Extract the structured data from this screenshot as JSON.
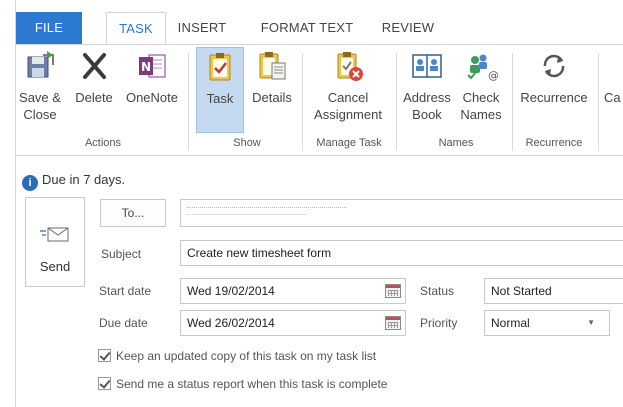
{
  "tabs": [
    {
      "label": "FILE"
    },
    {
      "label": "TASK"
    },
    {
      "label": "INSERT"
    },
    {
      "label": "FORMAT TEXT"
    },
    {
      "label": "REVIEW"
    }
  ],
  "ribbon": {
    "buttons": {
      "save_close": {
        "line1": "Save &",
        "line2": "Close",
        "icon": "save-close-icon"
      },
      "delete": {
        "line1": "Delete",
        "icon": "delete-x-icon"
      },
      "onenote": {
        "line1": "OneNote",
        "icon": "onenote-icon"
      },
      "task": {
        "line1": "Task",
        "icon": "task-clipboard-icon"
      },
      "details": {
        "line1": "Details",
        "icon": "details-clipboard-icon"
      },
      "cancel_assignment": {
        "line1": "Cancel",
        "line2": "Assignment",
        "icon": "cancel-assignment-icon"
      },
      "address_book": {
        "line1": "Address",
        "line2": "Book",
        "icon": "address-book-icon"
      },
      "check_names": {
        "line1": "Check",
        "line2": "Names",
        "icon": "check-names-icon"
      },
      "recurrence": {
        "line1": "Recurrence",
        "icon": "recurrence-icon"
      },
      "categorize": {
        "line1": "Ca"
      }
    },
    "groups": {
      "actions": "Actions",
      "show": "Show",
      "manage_task": "Manage Task",
      "names": "Names",
      "recurrence": "Recurrence"
    }
  },
  "info_bar": {
    "text": "Due in 7 days."
  },
  "send": {
    "label": "Send"
  },
  "form": {
    "to_button": "To...",
    "to_value": "",
    "subject_label": "Subject",
    "subject_value": "Create new timesheet form",
    "start_label": "Start date",
    "start_value": "Wed 19/02/2014",
    "due_label": "Due date",
    "due_value": "Wed 26/02/2014",
    "status_label": "Status",
    "status_value": "Not Started",
    "priority_label": "Priority",
    "priority_value": "Normal",
    "priority_arrow": "▼",
    "check_keep": "Keep an updated copy of this task on my task list",
    "check_status": "Send me a status report when this task is complete"
  },
  "colors": {
    "accent": "#2b79d0",
    "active_button": "#c5daf0"
  }
}
